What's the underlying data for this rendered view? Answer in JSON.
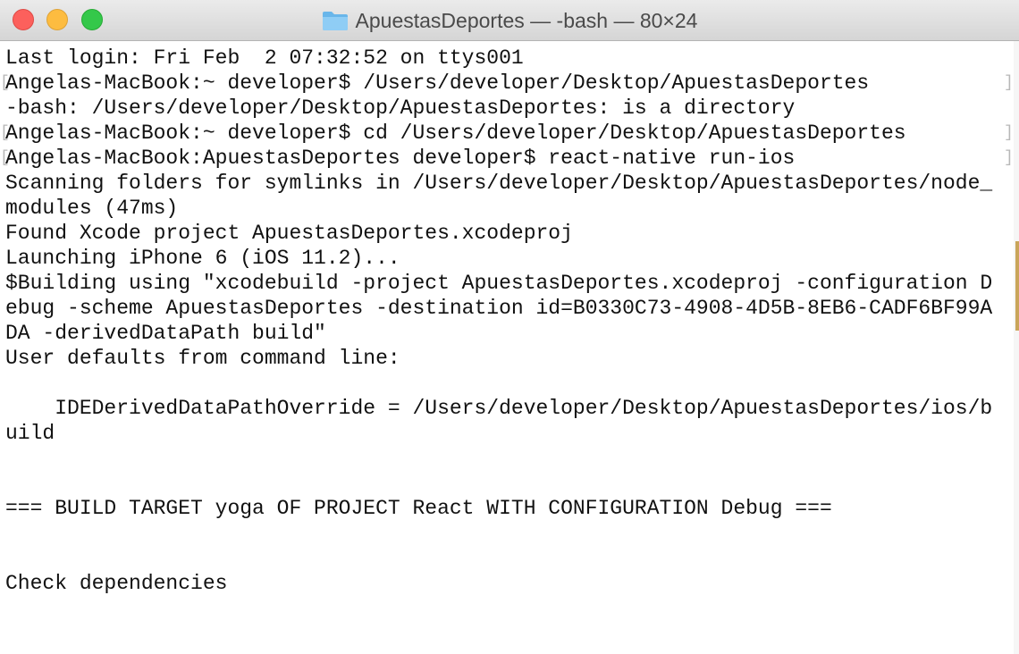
{
  "window": {
    "title": "ApuestasDeportes — -bash — 80×24",
    "folder_icon": "folder-icon",
    "colors": {
      "close": "#fc605c",
      "minimize": "#fdbc40",
      "maximize": "#34c84a"
    }
  },
  "terminal": {
    "lines": [
      "Last login: Fri Feb  2 07:32:52 on ttys001",
      "Angelas-MacBook:~ developer$ /Users/developer/Desktop/ApuestasDeportes",
      "-bash: /Users/developer/Desktop/ApuestasDeportes: is a directory",
      "Angelas-MacBook:~ developer$ cd /Users/developer/Desktop/ApuestasDeportes",
      "Angelas-MacBook:ApuestasDeportes developer$ react-native run-ios",
      "Scanning folders for symlinks in /Users/developer/Desktop/ApuestasDeportes/node_",
      "modules (47ms)",
      "Found Xcode project ApuestasDeportes.xcodeproj",
      "Launching iPhone 6 (iOS 11.2)...",
      "$Building using \"xcodebuild -project ApuestasDeportes.xcodeproj -configuration D",
      "ebug -scheme ApuestasDeportes -destination id=B0330C73-4908-4D5B-8EB6-CADF6BF99A",
      "DA -derivedDataPath build\"",
      "User defaults from command line:",
      "",
      "    IDEDerivedDataPathOverride = /Users/developer/Desktop/ApuestasDeportes/ios/b",
      "uild",
      "",
      "",
      "=== BUILD TARGET yoga OF PROJECT React WITH CONFIGURATION Debug ===",
      "",
      "",
      "Check dependencies"
    ],
    "prompt_marks": {
      "left": "[",
      "right": "]"
    }
  }
}
